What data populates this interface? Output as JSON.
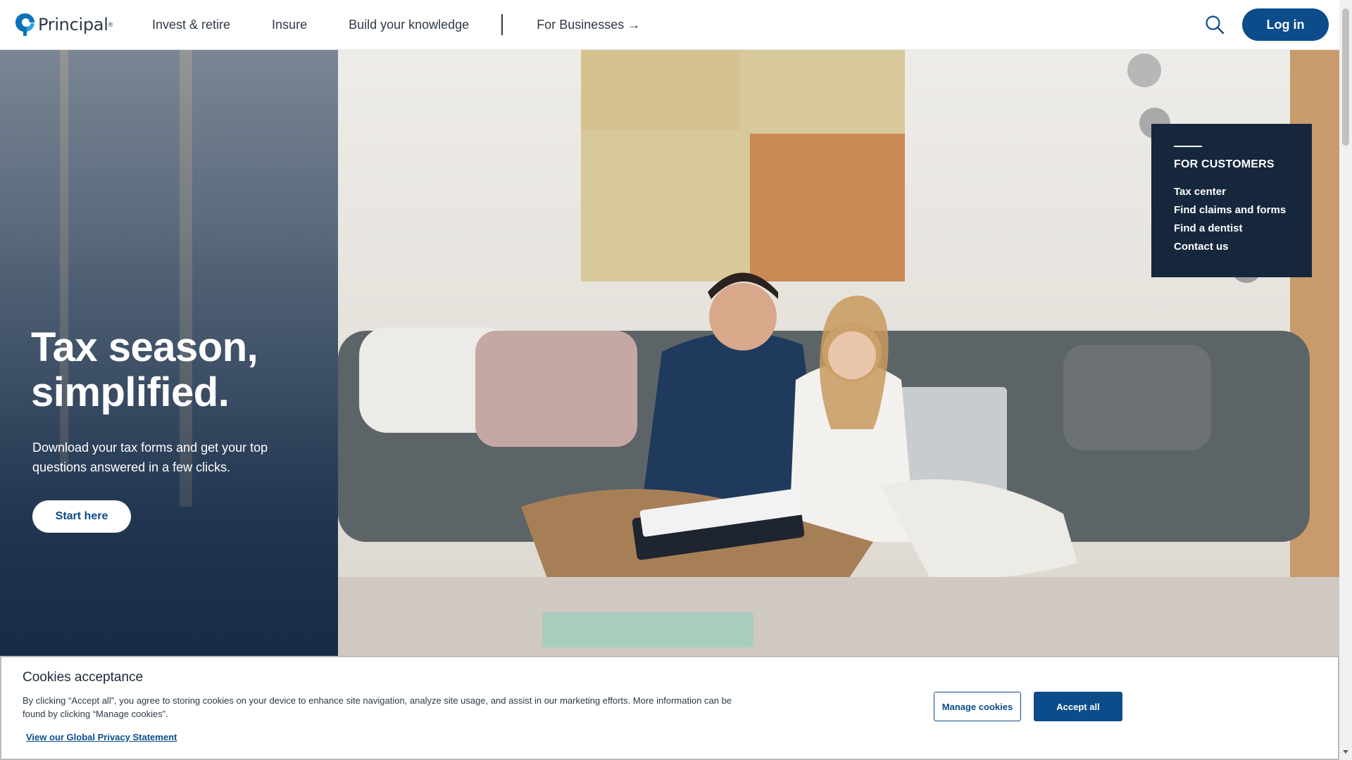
{
  "header": {
    "logo_text": "Principal",
    "logo_reg": "®",
    "nav": [
      "Invest & retire",
      "Insure",
      "Build your knowledge"
    ],
    "business_link": "For Businesses →",
    "login_label": "Log in"
  },
  "hero": {
    "title": "Tax season, simplified.",
    "subtitle": "Download your tax forms and get your top questions answered in a few clicks.",
    "cta_label": "Start here"
  },
  "customers_panel": {
    "heading": "FOR CUSTOMERS",
    "links": [
      "Tax center",
      "Find claims and forms",
      "Find a dentist",
      "Contact us"
    ]
  },
  "cookie_banner": {
    "title": "Cookies acceptance",
    "text": "By clicking “Accept all”, you agree to storing cookies on your device to enhance site navigation, analyze site usage, and assist in our marketing efforts. More information can be found by clicking “Manage cookies”.",
    "privacy_link": "View our Global Privacy Statement",
    "manage_label": "Manage cookies",
    "accept_label": "Accept all"
  },
  "colors": {
    "brand_blue": "#0c4c8a",
    "panel_navy": "#16273d"
  },
  "icons": {
    "logo": "principal-logo-icon",
    "search": "search-icon"
  }
}
